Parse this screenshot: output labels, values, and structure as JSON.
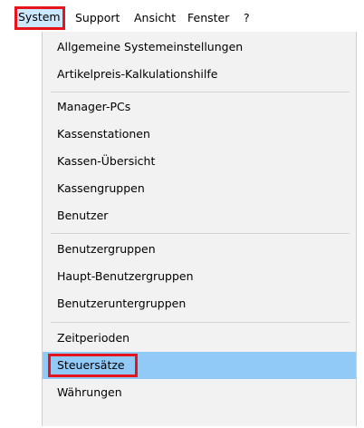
{
  "menubar": {
    "items": [
      "System",
      "Support",
      "Ansicht",
      "Fenster",
      "?"
    ]
  },
  "dropdown": {
    "items": [
      "Allgemeine Systemeinstellungen",
      "Artikelpreis-Kalkulationshilfe",
      "Manager-PCs",
      "Kassenstationen",
      "Kassen-Übersicht",
      "Kassengruppen",
      "Benutzer",
      "Benutzergruppen",
      "Haupt-Benutzergruppen",
      "Benutzeruntergruppen",
      "Zeitperioden",
      "Steuersätze",
      "Währungen"
    ],
    "highlighted_item": "Steuersätze"
  },
  "colors": {
    "highlight_outline": "#e8141c",
    "menu_hover": "#91c9f7",
    "menubar_active": "#cce8ff",
    "dropdown_background": "#f2f2f2"
  }
}
